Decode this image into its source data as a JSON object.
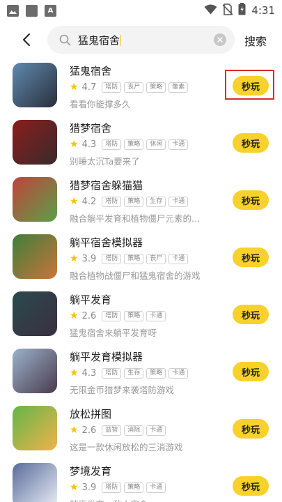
{
  "status_bar": {
    "time": "4:31",
    "left_icons": [
      "image-icon",
      "square-icon",
      "text-a-icon"
    ],
    "right_icons": [
      "wifi-icon",
      "no-sim-icon",
      "battery-icon"
    ]
  },
  "search": {
    "back_icon": "chevron-left-icon",
    "query": "猛鬼宿舍",
    "search_icon": "search-icon",
    "clear_icon": "clear-icon",
    "button_label": "搜索"
  },
  "results": [
    {
      "title": "猛鬼宿舍",
      "rating": "4.7",
      "tags": [
        "塔防",
        "丧尸",
        "策略",
        "像素"
      ],
      "desc": "看看你能撑多久",
      "button": "秒玩",
      "highlighted": true,
      "thumb_colors": [
        "#5e8ab0",
        "#2b2f3a"
      ]
    },
    {
      "title": "猎梦宿舍",
      "rating": "4.3",
      "tags": [
        "塔防",
        "策略",
        "休闲",
        "卡通"
      ],
      "desc": "别睡太沉Ta要来了",
      "button": "秒玩",
      "highlighted": false,
      "thumb_colors": [
        "#8a1e1e",
        "#3a2a2a"
      ]
    },
    {
      "title": "猎梦宿舍躲猫猫",
      "rating": "4.2",
      "tags": [
        "塔防",
        "策略",
        "生存",
        "卡通"
      ],
      "desc": "融合躺平发育和植物僵尸元素的...",
      "button": "秒玩",
      "highlighted": false,
      "thumb_colors": [
        "#c0433a",
        "#5aa04a"
      ]
    },
    {
      "title": "躺平宿舍模拟器",
      "rating": "3.9",
      "tags": [
        "塔防",
        "策略",
        "丧尸",
        "卡通"
      ],
      "desc": "融合植物战僵尸和猛鬼宿舍的游戏",
      "button": "秒玩",
      "highlighted": false,
      "thumb_colors": [
        "#3f7f3a",
        "#c9743a"
      ]
    },
    {
      "title": "躺平发育",
      "rating": "2.6",
      "tags": [
        "塔防",
        "策略",
        "卡通"
      ],
      "desc": "猛鬼宿舍来躺平发育呀",
      "button": "秒玩",
      "highlighted": false,
      "thumb_colors": [
        "#2a4a4e",
        "#3b2f40"
      ]
    },
    {
      "title": "躺平发育模拟器",
      "rating": "4.3",
      "tags": [
        "塔防",
        "生存",
        "策略",
        "卡通"
      ],
      "desc": "无限金币猎梦来袭塔防游戏",
      "button": "秒玩",
      "highlighted": false,
      "thumb_colors": [
        "#9bb2c9",
        "#4a3b4f"
      ]
    },
    {
      "title": "放松拼图",
      "rating": "2.6",
      "tags": [
        "益智",
        "消除",
        "卡通"
      ],
      "desc": "这是一款休闲放松的三消游戏",
      "button": "秒玩",
      "highlighted": false,
      "thumb_colors": [
        "#62b64a",
        "#f0b24a"
      ]
    },
    {
      "title": "梦境发育",
      "rating": "3.9",
      "tags": [
        "塔防",
        "策略",
        "卡通"
      ],
      "desc": "躺平发育，敌人宿舍",
      "button": "秒玩",
      "highlighted": false,
      "thumb_colors": [
        "#5a6b9a",
        "#e9eef6"
      ]
    }
  ]
}
